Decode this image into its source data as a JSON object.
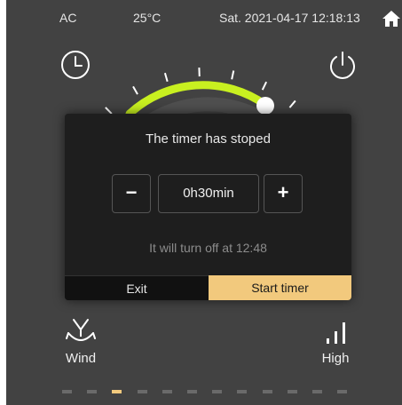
{
  "status_bar": {
    "mode": "AC",
    "temperature": "25°C",
    "datetime": "Sat. 2021-04-17 12:18:13",
    "home_icon": "home-icon"
  },
  "header_icons": {
    "timer": "clock-icon",
    "power": "power-icon"
  },
  "dial": {
    "accent_color": "#c8f020",
    "track_color": "#4f4f4f",
    "knob_color": "#ffffff",
    "set_level": 0.5
  },
  "timer_dialog": {
    "title": "The timer has stoped",
    "minus_label": "−",
    "duration": "0h30min",
    "plus_label": "+",
    "info": "It will turn off at 12:48",
    "exit_label": "Exit",
    "start_label": "Start timer",
    "start_color": "#f2c97d"
  },
  "controls": {
    "wind": {
      "label": "Wind",
      "icon": "fan-swing-icon"
    },
    "fan_speed": {
      "label": "High",
      "icon": "signal-bars-icon"
    }
  },
  "pagination": {
    "count": 12,
    "active_index": 2
  }
}
